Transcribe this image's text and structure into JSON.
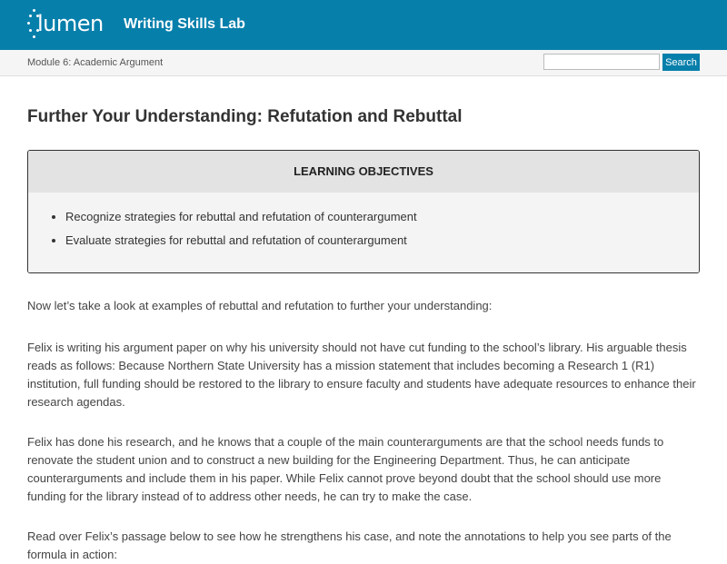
{
  "header": {
    "logo_text": "lumen",
    "site_title": "Writing Skills Lab"
  },
  "subheader": {
    "breadcrumb": "Module 6: Academic Argument",
    "search_placeholder": "",
    "search_button_label": "Search"
  },
  "main": {
    "page_title": "Further Your Understanding: Refutation and Rebuttal",
    "objectives": {
      "heading": "LEARNING OBJECTIVES",
      "items": [
        "Recognize strategies for rebuttal and refutation of counterargument",
        "Evaluate strategies for rebuttal and refutation of counterargument"
      ]
    },
    "paragraphs": [
      "Now let’s take a look at examples of rebuttal and refutation to further your understanding:",
      "Felix is writing his argument paper on why his university should not have cut funding to the school’s library. His arguable thesis reads as follows: Because Northern State University has a mission statement that includes becoming a Research 1 (R1) institution, full funding should be restored to the library to ensure faculty and students have adequate resources to enhance their research agendas.",
      "Felix has done his research, and he knows that a couple of the main counterarguments are that the school needs funds to renovate the student union and to construct a new building for the Engineering Department. Thus, he can anticipate counterarguments and include them in his paper. While Felix cannot prove beyond doubt that the school should use more funding for the library instead of to address other needs, he can try to make the case.",
      "Read over Felix’s passage below to see how he strengthens his case, and note the annotations to help you see parts of the formula in action:"
    ]
  },
  "colors": {
    "brand": "#077fab"
  }
}
